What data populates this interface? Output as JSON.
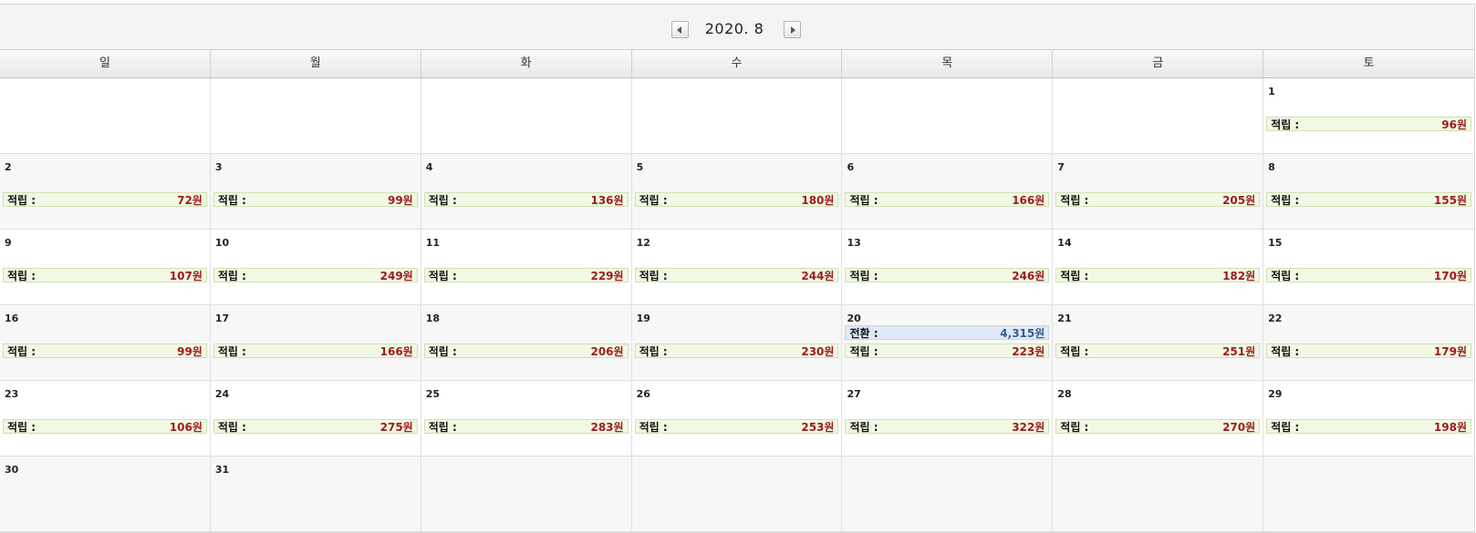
{
  "header": {
    "month_label": "2020. 8"
  },
  "weekdays": [
    "일",
    "월",
    "화",
    "수",
    "목",
    "금",
    "토"
  ],
  "labels": {
    "accumulate": "적립 :",
    "convert": "전환 :"
  },
  "weeks": [
    [
      {
        "day": ""
      },
      {
        "day": ""
      },
      {
        "day": ""
      },
      {
        "day": ""
      },
      {
        "day": ""
      },
      {
        "day": ""
      },
      {
        "day": "1",
        "amount": "96원"
      }
    ],
    [
      {
        "day": "2",
        "amount": "72원"
      },
      {
        "day": "3",
        "amount": "99원"
      },
      {
        "day": "4",
        "amount": "136원"
      },
      {
        "day": "5",
        "amount": "180원"
      },
      {
        "day": "6",
        "amount": "166원"
      },
      {
        "day": "7",
        "amount": "205원"
      },
      {
        "day": "8",
        "amount": "155원"
      }
    ],
    [
      {
        "day": "9",
        "amount": "107원"
      },
      {
        "day": "10",
        "amount": "249원"
      },
      {
        "day": "11",
        "amount": "229원"
      },
      {
        "day": "12",
        "amount": "244원"
      },
      {
        "day": "13",
        "amount": "246원"
      },
      {
        "day": "14",
        "amount": "182원"
      },
      {
        "day": "15",
        "amount": "170원"
      }
    ],
    [
      {
        "day": "16",
        "amount": "99원"
      },
      {
        "day": "17",
        "amount": "166원"
      },
      {
        "day": "18",
        "amount": "206원"
      },
      {
        "day": "19",
        "amount": "230원"
      },
      {
        "day": "20",
        "amount": "223원",
        "convert": "4,315원"
      },
      {
        "day": "21",
        "amount": "251원"
      },
      {
        "day": "22",
        "amount": "179원"
      }
    ],
    [
      {
        "day": "23",
        "amount": "106원"
      },
      {
        "day": "24",
        "amount": "275원"
      },
      {
        "day": "25",
        "amount": "283원"
      },
      {
        "day": "26",
        "amount": "253원"
      },
      {
        "day": "27",
        "amount": "322원"
      },
      {
        "day": "28",
        "amount": "270원"
      },
      {
        "day": "29",
        "amount": "198원"
      }
    ],
    [
      {
        "day": "30"
      },
      {
        "day": "31"
      },
      {
        "day": ""
      },
      {
        "day": ""
      },
      {
        "day": ""
      },
      {
        "day": ""
      },
      {
        "day": ""
      }
    ]
  ]
}
